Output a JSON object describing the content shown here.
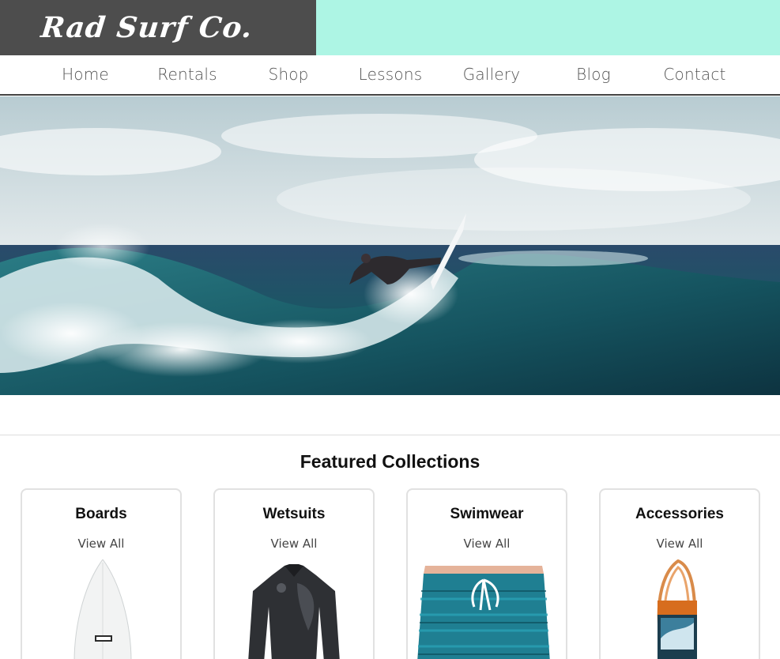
{
  "brand": {
    "logo_text": "Rad Surf Co.",
    "colors": {
      "logo_bg": "#4d4d4d",
      "accent": "#adf5e4",
      "text": "#111111"
    }
  },
  "nav": {
    "items": [
      {
        "label": "Home"
      },
      {
        "label": "Rentals"
      },
      {
        "label": "Shop"
      },
      {
        "label": "Lessons"
      },
      {
        "label": "Gallery"
      },
      {
        "label": "Blog"
      },
      {
        "label": "Contact"
      }
    ]
  },
  "hero": {
    "image": "surfer-riding-wave-photo"
  },
  "featured": {
    "title": "Featured Collections",
    "collections": [
      {
        "title": "Boards",
        "link": "View All",
        "image": "surfboard-image"
      },
      {
        "title": "Wetsuits",
        "link": "View All",
        "image": "wetsuit-image"
      },
      {
        "title": "Swimwear",
        "link": "View All",
        "image": "boardshorts-image"
      },
      {
        "title": "Accessories",
        "link": "View All",
        "image": "surf-leash-image"
      }
    ]
  }
}
